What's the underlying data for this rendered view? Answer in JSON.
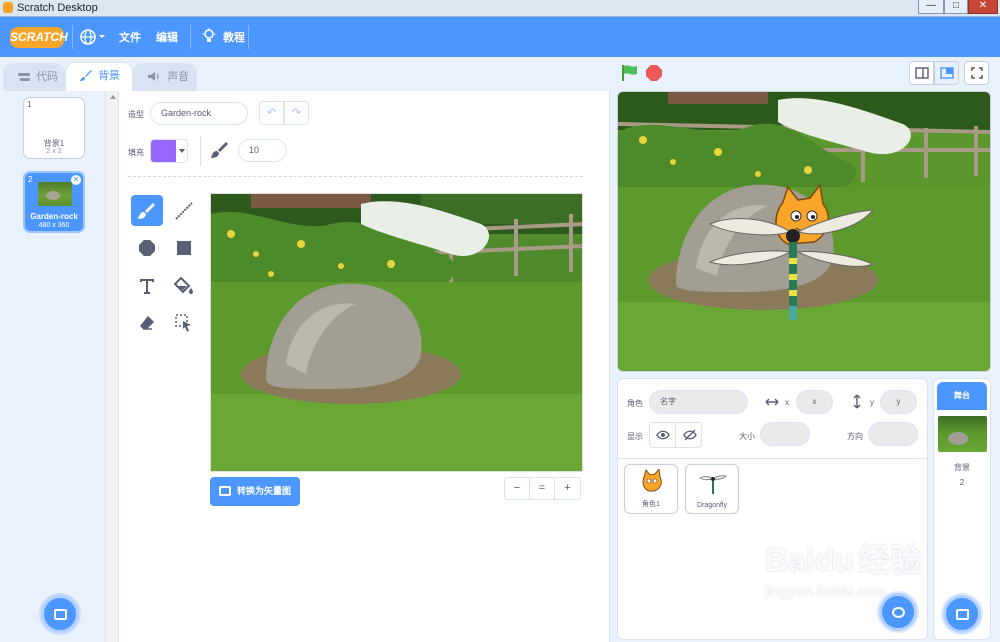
{
  "window": {
    "title": "Scratch Desktop",
    "minimize": "—",
    "maximize": "□",
    "close": "✕"
  },
  "menu": {
    "brand": "SCRATCH",
    "file": "文件",
    "edit": "编辑",
    "tutorials": "教程"
  },
  "tabs": [
    {
      "label": "代码"
    },
    {
      "label": "背景"
    },
    {
      "label": "声音"
    }
  ],
  "costumes": [
    {
      "num": "1",
      "name": "背景1",
      "size": "2 x 2"
    },
    {
      "num": "2",
      "name": "Garden-rock",
      "size": "480 x 360"
    }
  ],
  "editor": {
    "shape_label": "造型",
    "costume_name": "Garden-rock",
    "fill_label": "填充",
    "fill_color": "#9966ff",
    "brush_size": "10",
    "convert_button": "转换为矢量图",
    "zoom_out": "−",
    "zoom_reset": "=",
    "zoom_in": "+"
  },
  "sprite_info": {
    "sprite_label": "角色",
    "name_placeholder": "名字",
    "x_label": "x",
    "x_placeholder": "x",
    "y_label": "y",
    "y_placeholder": "y",
    "show_label": "显示",
    "size_label": "大小",
    "direction_label": "方向"
  },
  "sprites": [
    {
      "name": "角色1"
    },
    {
      "name": "Dragonfly"
    }
  ],
  "stage_panel": {
    "header": "舞台",
    "backdrops_label": "背景",
    "backdrops_count": "2"
  },
  "watermark": {
    "brand": "Baidu",
    "cn": "经验",
    "url": "jingyan.baidu.com"
  },
  "colors": {
    "accent": "#4c97ff",
    "menubar": "#4c97ff",
    "green_flag": "#4cbf56",
    "stop": "#ec5959"
  }
}
